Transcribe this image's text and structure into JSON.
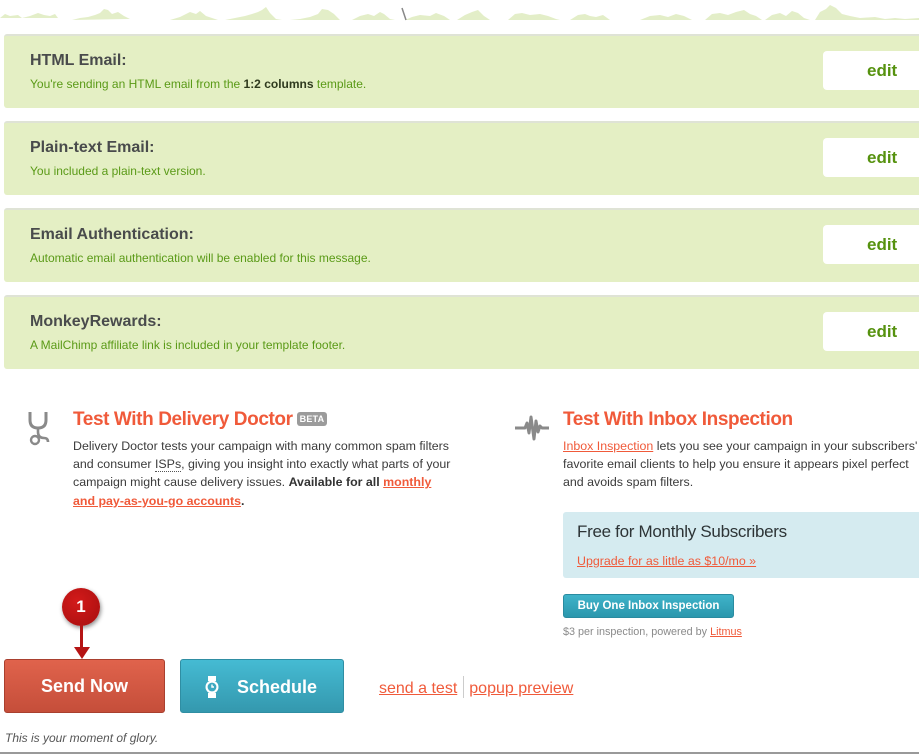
{
  "checks": [
    {
      "title": "HTML Email:",
      "desc_before": "You're sending an HTML email from the ",
      "desc_bold": "1:2 columns",
      "desc_after": " template.",
      "edit_label": "edit"
    },
    {
      "title": "Plain-text Email:",
      "desc": "You included a plain-text version.",
      "edit_label": "edit"
    },
    {
      "title": "Email Authentication:",
      "desc": "Automatic email authentication will be enabled for this message.",
      "edit_label": "edit"
    },
    {
      "title": "MonkeyRewards:",
      "desc": "A MailChimp affiliate link is included in your template footer.",
      "edit_label": "edit"
    }
  ],
  "delivery_doctor": {
    "icon": "stethoscope-icon",
    "title": "Test With Delivery Doctor",
    "badge": "BETA",
    "body_1": "Delivery Doctor tests your campaign with many common spam filters and consumer ",
    "abbr": "ISPs",
    "body_2": ", giving you insight into exactly what parts of your campaign might cause delivery issues. ",
    "body_bold": "Available for all",
    "link": "monthly and pay-as-you-go accounts",
    "body_end": "."
  },
  "inbox_inspection": {
    "icon": "pulse-icon",
    "title": "Test With Inbox Inspection",
    "link": "Inbox Inspection",
    "body": " lets you see your campaign in your subscribers' favorite email clients to help you ensure it appears pixel perfect and avoids spam filters.",
    "upsell_title": "Free for Monthly Subscribers",
    "upsell_link": "Upgrade for as little as $10/mo »",
    "buy_label": "Buy One Inbox Inspection",
    "note_before": "$3 per inspection, powered by ",
    "note_link": "Litmus"
  },
  "marker": {
    "number": "1"
  },
  "actions": {
    "send_now": "Send Now",
    "schedule": "Schedule",
    "send_test": "send a test",
    "popup_preview": "popup preview"
  },
  "tagline": "This is your moment of glory.",
  "colors": {
    "panel_bg": "#e4efc4",
    "accent_orange": "#f05a3a",
    "send_red": "#d85a45",
    "schedule_teal": "#3ea9c1",
    "desc_green": "#5a9a17"
  }
}
